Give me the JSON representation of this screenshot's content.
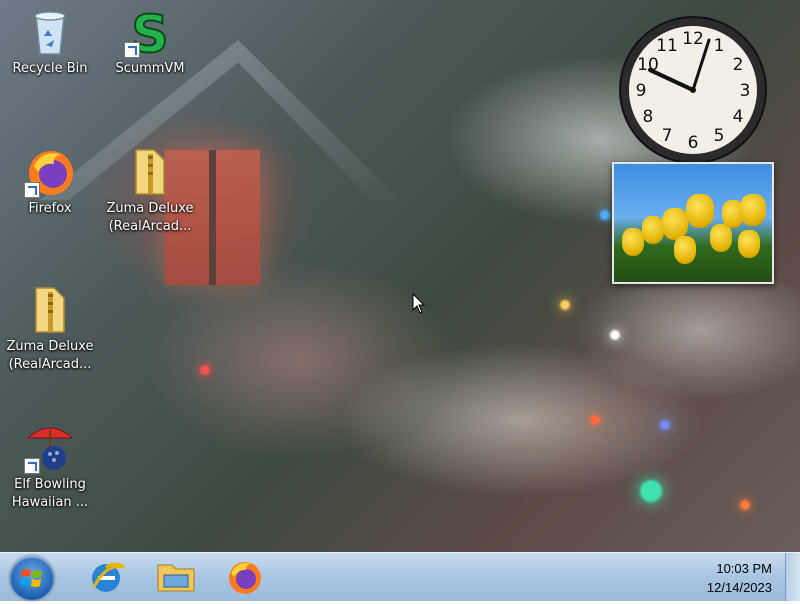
{
  "desktop": {
    "icons": [
      {
        "label": "Recycle Bin",
        "icon": "recycle-bin-icon"
      },
      {
        "label": "ScummVM",
        "icon": "scummvm-icon"
      },
      {
        "label": "Firefox",
        "icon": "firefox-icon"
      },
      {
        "label": "Zuma Deluxe\n(RealArcad...",
        "icon": "folder-icon"
      },
      {
        "label": "Zuma Deluxe\n(RealArcad...",
        "icon": "folder-icon"
      },
      {
        "label": "Elf Bowling\nHawaiian ...",
        "icon": "elf-bowling-icon"
      }
    ]
  },
  "gadgets": {
    "clock": {
      "numbers": [
        "12",
        "1",
        "2",
        "3",
        "4",
        "5",
        "6",
        "7",
        "8",
        "9",
        "10",
        "11"
      ],
      "time_display": "10:03"
    },
    "slideshow": {
      "subject": "yellow tulips"
    }
  },
  "taskbar": {
    "start_icon": "windows-logo-icon",
    "apps": [
      {
        "icon": "internet-explorer-icon"
      },
      {
        "icon": "file-explorer-icon"
      },
      {
        "icon": "firefox-icon"
      }
    ],
    "tray": {
      "time": "10:03 PM",
      "date": "12/14/2023"
    }
  },
  "colors": {
    "taskbar": "#a9c5e2",
    "accent_blue": "#1b5fb0"
  }
}
